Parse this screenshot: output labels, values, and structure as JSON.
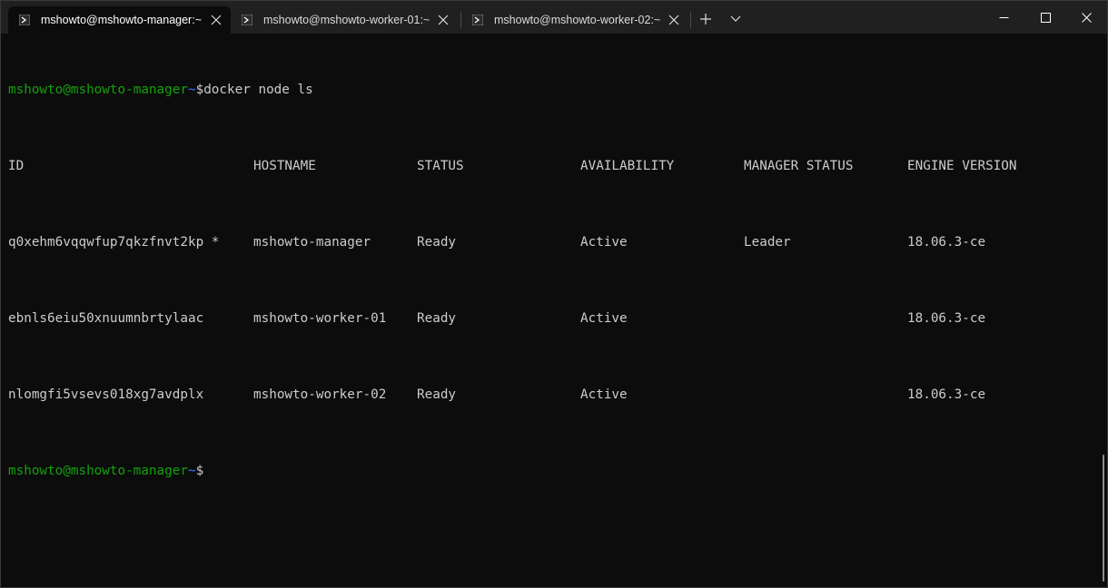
{
  "tabs": [
    {
      "label": "mshowto@mshowto-manager:~",
      "active": true
    },
    {
      "label": "mshowto@mshowto-worker-01:~",
      "active": false
    },
    {
      "label": "mshowto@mshowto-worker-02:~",
      "active": false
    }
  ],
  "terminal": {
    "prompt_user": "mshowto@mshowto-manager",
    "prompt_dir": "~",
    "prompt_symbol": "$",
    "command": "docker node ls",
    "headers": [
      "ID",
      "HOSTNAME",
      "STATUS",
      "AVAILABILITY",
      "MANAGER STATUS",
      "ENGINE VERSION"
    ],
    "rows": [
      [
        "q0xehm6vqqwfup7qkzfnvt2kp *",
        "mshowto-manager",
        "Ready",
        "Active",
        "Leader",
        "18.06.3-ce"
      ],
      [
        "ebnls6eiu50xnuumnbrtylaac",
        "mshowto-worker-01",
        "Ready",
        "Active",
        "",
        "18.06.3-ce"
      ],
      [
        "nlomgfi5vsevs018xg7avdplx",
        "mshowto-worker-02",
        "Ready",
        "Active",
        "",
        "18.06.3-ce"
      ]
    ]
  },
  "colors": {
    "background": "#0c0c0c",
    "titlebar": "#202020",
    "prompt_user": "#13a10e",
    "prompt_dir": "#3b78ff",
    "text": "#cccccc"
  }
}
